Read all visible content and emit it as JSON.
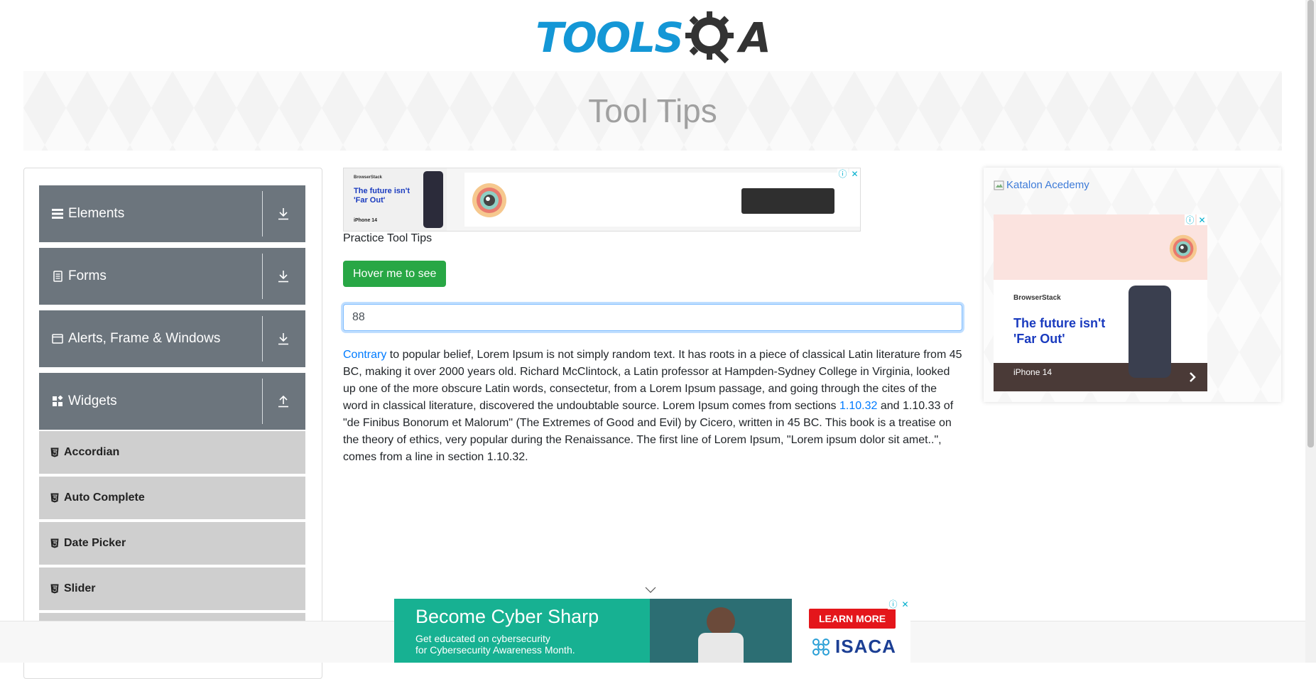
{
  "logo": {
    "text_main": "TOOLS",
    "text_q": "Q",
    "text_a": "A",
    "brand_color": "#1497d6"
  },
  "banner": {
    "title": "Tool Tips"
  },
  "sidebar": {
    "groups": [
      {
        "label": "Elements",
        "icon": "hamburger-icon",
        "expanded": false
      },
      {
        "label": "Forms",
        "icon": "document-icon",
        "expanded": false
      },
      {
        "label": "Alerts, Frame & Windows",
        "icon": "window-icon",
        "expanded": false
      },
      {
        "label": "Widgets",
        "icon": "widgets-icon",
        "expanded": true
      }
    ],
    "items": [
      {
        "label": "Accordian"
      },
      {
        "label": "Auto Complete"
      },
      {
        "label": "Date Picker"
      },
      {
        "label": "Slider"
      }
    ]
  },
  "ad_top": {
    "brand": "BrowserStack",
    "headline": "The future isn't 'Far Out'",
    "product": "iPhone 14"
  },
  "main": {
    "section_title": "Practice Tool Tips",
    "hover_button": "Hover me to see",
    "input_value": "88",
    "paragraph": {
      "link1": "Contrary",
      "text1": " to popular belief, Lorem Ipsum is not simply random text. It has roots in a piece of classical Latin literature from 45 BC, making it over 2000 years old. Richard McClintock, a Latin professor at Hampden-Sydney College in Virginia, looked up one of the more obscure Latin words, consectetur, from a Lorem Ipsum passage, and going through the cites of the word in classical literature, discovered the undoubtable source. Lorem Ipsum comes from sections ",
      "link2": "1.10.32",
      "text2": " and 1.10.33 of \"de Finibus Bonorum et Malorum\" (The Extremes of Good and Evil) by Cicero, written in 45 BC. This book is a treatise on the theory of ethics, very popular during the Renaissance. The first line of Lorem Ipsum, \"Lorem ipsum dolor sit amet..\", comes from a line in section 1.10.32."
    }
  },
  "right_ad": {
    "katalon_alt": "Katalon Acedemy",
    "brand": "BrowserStack",
    "headline": "The future isn't 'Far Out'",
    "product": "iPhone 14"
  },
  "bottom_ad": {
    "headline": "Become Cyber Sharp",
    "sub1": "Get educated on cybersecurity",
    "sub2": "for Cybersecurity Awareness Month.",
    "cta": "LEARN MORE",
    "brand": "ISACA"
  },
  "colors": {
    "sidebar_group": "#6c757d",
    "sidebar_item": "#cfcfcf",
    "button_green": "#28a745",
    "link": "#007bff"
  }
}
